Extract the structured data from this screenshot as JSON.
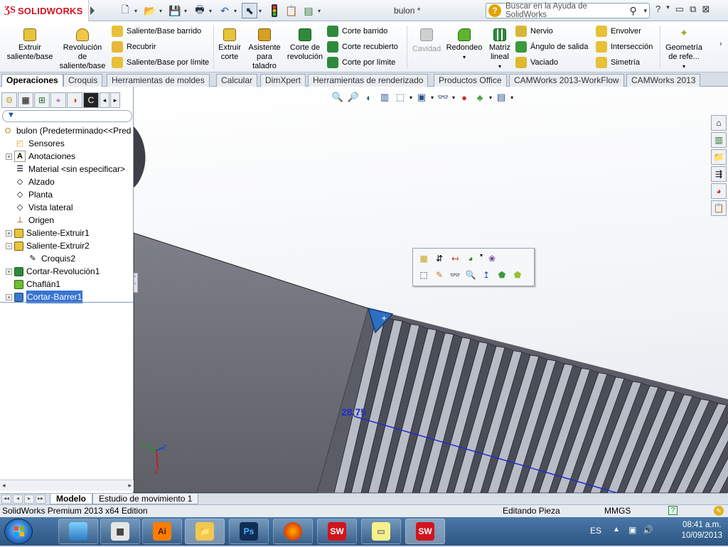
{
  "titlebar": {
    "app_logo": "SOLIDWORKS",
    "document_title": "bulon *",
    "help_search_placeholder": "Buscar en la Ayuda de SolidWorks"
  },
  "ribbon": {
    "large_buttons": [
      {
        "label": "Extruir saliente/base",
        "icon": "extrude-boss-icon"
      },
      {
        "label": "Revolución de saliente/base",
        "icon": "revolve-boss-icon"
      },
      {
        "label": "Extruir corte",
        "icon": "extruded-cut-icon"
      },
      {
        "label": "Asistente para taladro",
        "icon": "hole-wizard-icon"
      },
      {
        "label": "Corte de revolución",
        "icon": "revolved-cut-icon"
      },
      {
        "label": "Cavidad",
        "icon": "cavity-icon",
        "disabled": true
      },
      {
        "label": "Redondeo",
        "icon": "fillet-icon"
      },
      {
        "label": "Matriz lineal",
        "icon": "linear-pattern-icon"
      },
      {
        "label": "Geometría de refe...",
        "icon": "reference-geometry-icon"
      }
    ],
    "small_buttons_col1": [
      "Saliente/Base barrido",
      "Recubrir",
      "Saliente/Base por límite"
    ],
    "small_buttons_col2": [
      "Corte barrido",
      "Corte recubierto",
      "Corte por límite"
    ],
    "small_buttons_col3": [
      "Nervio",
      "Ángulo de salida",
      "Vaciado"
    ],
    "small_buttons_col4": [
      "Envolver",
      "Intersección",
      "Simetría"
    ]
  },
  "command_tabs": [
    "Operaciones",
    "Croquis",
    "Herramientas de moldes",
    "Calcular",
    "DimXpert",
    "Herramientas de renderizado",
    "Productos Office",
    "CAMWorks 2013-WorkFlow",
    "CAMWorks 2013"
  ],
  "feature_tree": {
    "root": "bulon  (Predeterminado<<Pred",
    "items": [
      {
        "label": "Sensores",
        "expandable": false
      },
      {
        "label": "Anotaciones",
        "expandable": true
      },
      {
        "label": "Material <sin especificar>",
        "expandable": false
      },
      {
        "label": "Alzado",
        "expandable": false
      },
      {
        "label": "Planta",
        "expandable": false
      },
      {
        "label": "Vista lateral",
        "expandable": false
      },
      {
        "label": "Origen",
        "expandable": false
      },
      {
        "label": "Saliente-Extruir1",
        "expandable": true
      },
      {
        "label": "Saliente-Extruir2",
        "expandable": true,
        "expanded": true
      },
      {
        "label": "Croquis2",
        "child": true
      },
      {
        "label": "Cortar-Revolución1",
        "expandable": true
      },
      {
        "label": "Chaflán1",
        "expandable": false
      },
      {
        "label": "Cortar-Barrer1",
        "expandable": true,
        "selected": true
      }
    ]
  },
  "viewport": {
    "dimension_value": "28.75",
    "triad": {
      "x": "X",
      "y": "Y",
      "z": "Z"
    }
  },
  "bottom_tabs": [
    "Modelo",
    "Estudio de movimiento 1"
  ],
  "statusbar": {
    "edition": "SolidWorks Premium 2013 x64 Edition",
    "mode": "Editando Pieza",
    "units": "MMGS"
  },
  "taskbar": {
    "language": "ES",
    "time": "08:41 a.m.",
    "date": "10/09/2013",
    "apps": [
      "Ai",
      "Ps",
      "SW",
      "SW"
    ]
  },
  "colors": {
    "accent_blue": "#3874d0",
    "sw_red": "#d2141e",
    "dimension_blue": "#1f2ccc"
  }
}
